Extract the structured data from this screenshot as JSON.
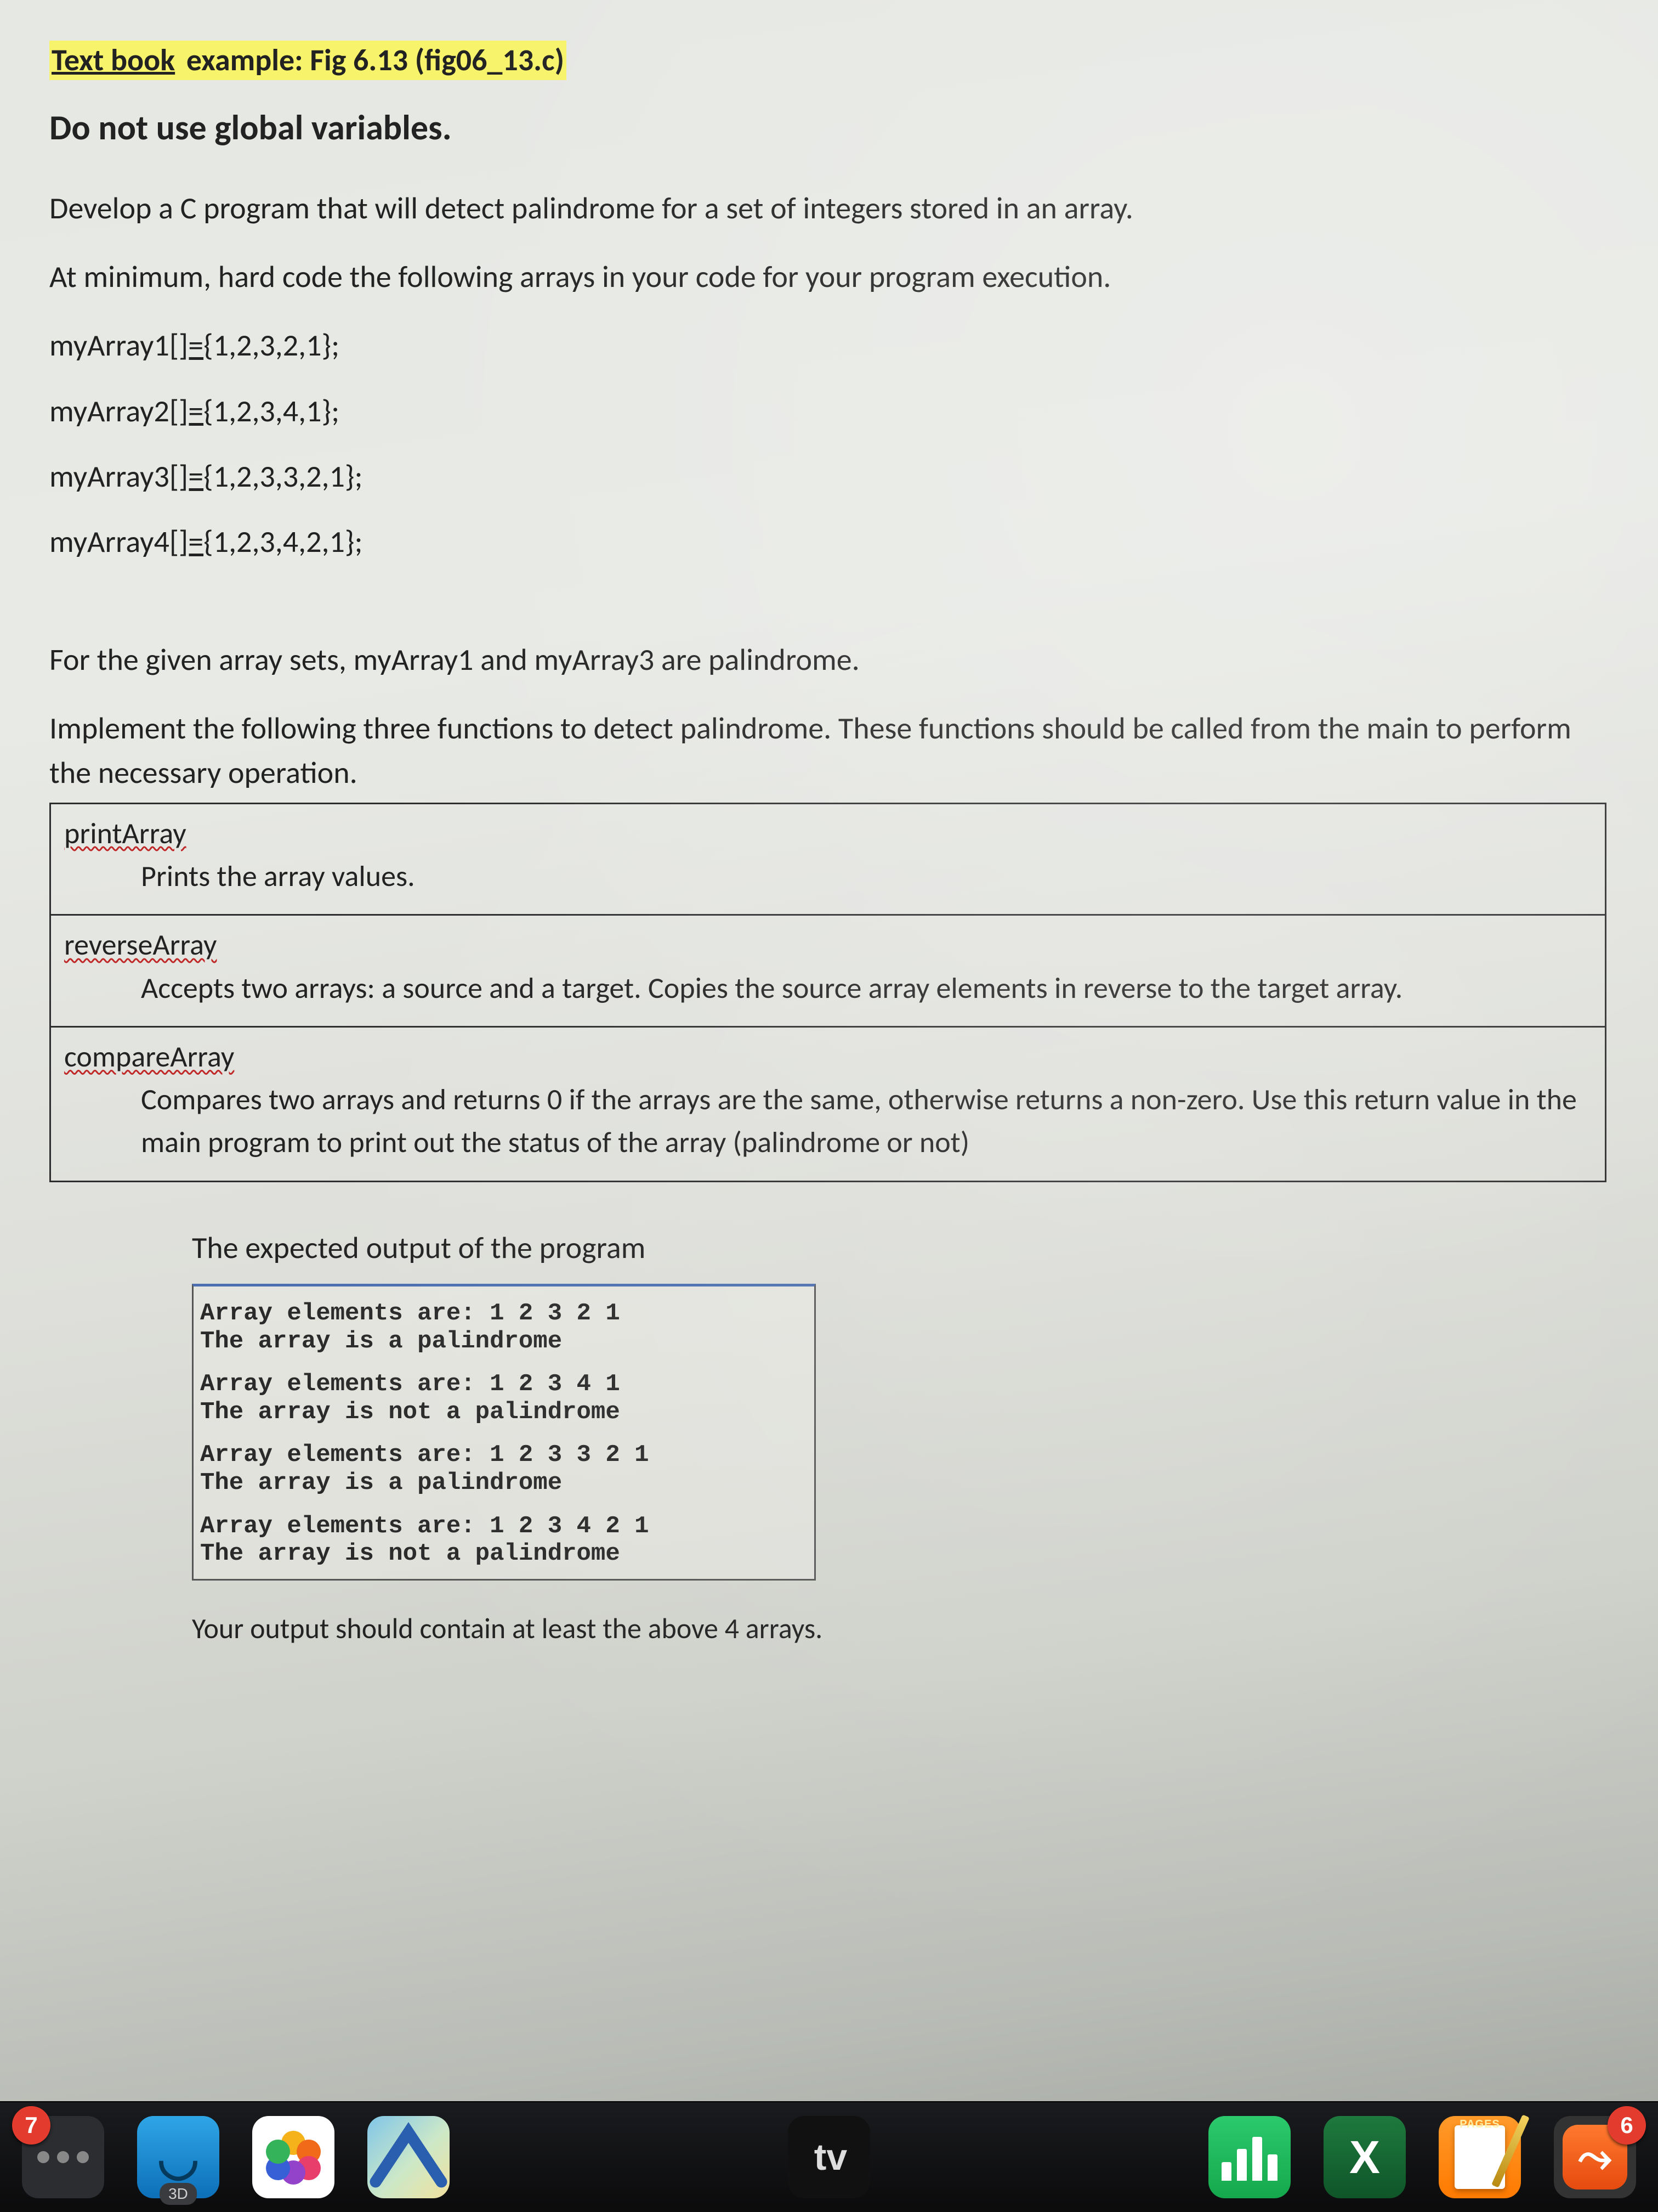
{
  "header": {
    "highlighted": "Text book",
    "rest": " example: Fig 6.13 (fig06_13.c)",
    "rule": "Do not use global variables."
  },
  "body": {
    "p1": "Develop a C program that will detect palindrome for a set of integers stored in an array.",
    "p2": "At minimum, hard code the following arrays in your code for your program execution.",
    "arr1a": "myArray1",
    "arr1b": "[]=",
    "arr1c": "{1,2,3,2,1};",
    "arr2a": "myArray2",
    "arr2b": "[]=",
    "arr2c": "{1,2,3,4,1};",
    "arr3a": "myArray3",
    "arr3b": "[]=",
    "arr3c": "{1,2,3,3,2,1};",
    "arr4a": "myArray4",
    "arr4b": "[]=",
    "arr4c": "{1,2,3,4,2,1};",
    "p3": "For the given array sets, myArray1 and myArray3 are palindrome.",
    "p4": "Implement the following three functions to detect palindrome. These functions should be called from the main to perform the necessary operation."
  },
  "functions": [
    {
      "name": "printArray",
      "desc": "Prints the array values."
    },
    {
      "name": "reverseArray",
      "desc": "Accepts two arrays: a source and a target. Copies the source array elements in reverse to the target array."
    },
    {
      "name": "compareArray",
      "desc": "Compares two arrays and returns 0 if the arrays are the same, otherwise returns a non-zero. Use this return value in the main program to print out the status of the array (palindrome or not)"
    }
  ],
  "output": {
    "title": "The expected output of the program",
    "blocks": [
      {
        "l1": "Array elements are: 1 2 3 2 1",
        "l2": "The array is a palindrome"
      },
      {
        "l1": "Array elements are: 1 2 3 4 1",
        "l2": "The array is not a palindrome"
      },
      {
        "l1": "Array elements are: 1 2 3 3 2 1",
        "l2": "The array is a palindrome"
      },
      {
        "l1": "Array elements are: 1 2 3 4 2 1",
        "l2": "The array is not a palindrome"
      }
    ],
    "note": "Your output should contain at least the above 4 arrays."
  },
  "dock": {
    "badge_left": "7",
    "threed": "3D",
    "tv": "tv",
    "excel": "X",
    "pages": "PAGES",
    "badge_right": "6"
  }
}
